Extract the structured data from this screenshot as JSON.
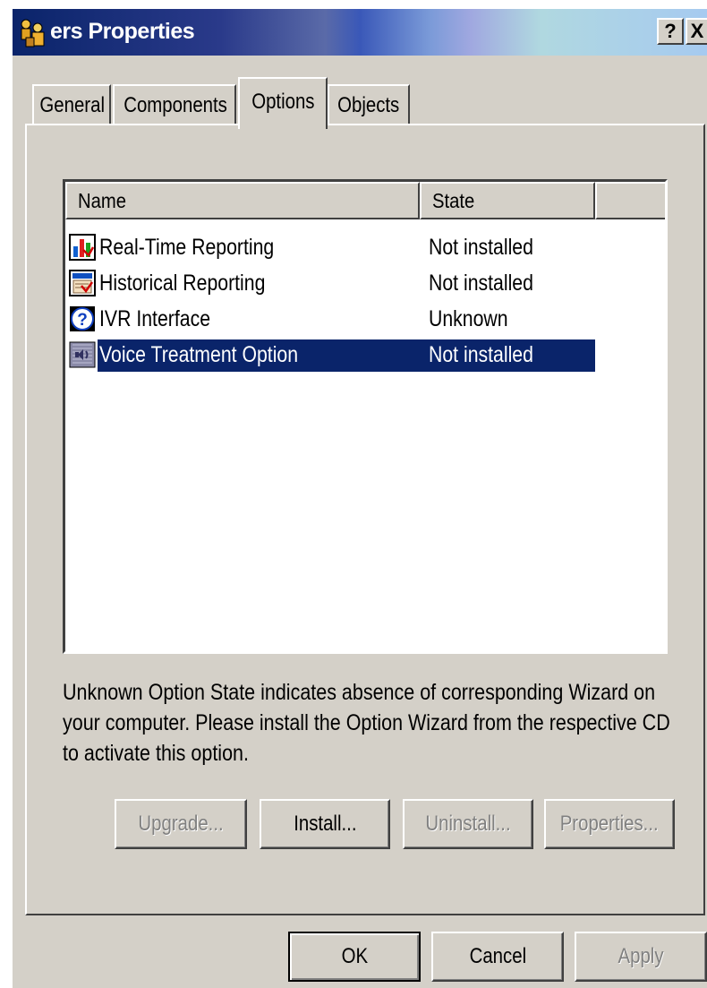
{
  "window": {
    "title": "ers Properties",
    "app_icon": "people-group-icon",
    "help_label": "?",
    "close_label": "X"
  },
  "tabs": [
    {
      "label": "General",
      "active": false
    },
    {
      "label": "Components",
      "active": false
    },
    {
      "label": "Options",
      "active": true
    },
    {
      "label": "Objects",
      "active": false
    }
  ],
  "options_list": {
    "columns": [
      "Name",
      "State",
      ""
    ],
    "rows": [
      {
        "name": "Real-Time Reporting",
        "state": "Not installed",
        "icon": "realtime-report-icon",
        "selected": false
      },
      {
        "name": "Historical Reporting",
        "state": "Not installed",
        "icon": "historical-report-icon",
        "selected": false
      },
      {
        "name": "IVR Interface",
        "state": "Unknown",
        "icon": "question-icon",
        "selected": false
      },
      {
        "name": "Voice Treatment Option",
        "state": "Not installed",
        "icon": "voice-treatment-icon",
        "selected": true
      }
    ]
  },
  "info_text": "Unknown Option State indicates absence of corresponding Wizard on your computer. Please install the Option Wizard from the respective CD to activate this option.",
  "option_buttons": {
    "upgrade": "Upgrade...",
    "install": "Install...",
    "uninstall": "Uninstall...",
    "properties": "Properties..."
  },
  "dialog_buttons": {
    "ok": "OK",
    "cancel": "Cancel",
    "apply": "Apply"
  },
  "colors": {
    "selection": "#0a246a",
    "face": "#d4d0c8",
    "disabled_text": "#808080"
  }
}
